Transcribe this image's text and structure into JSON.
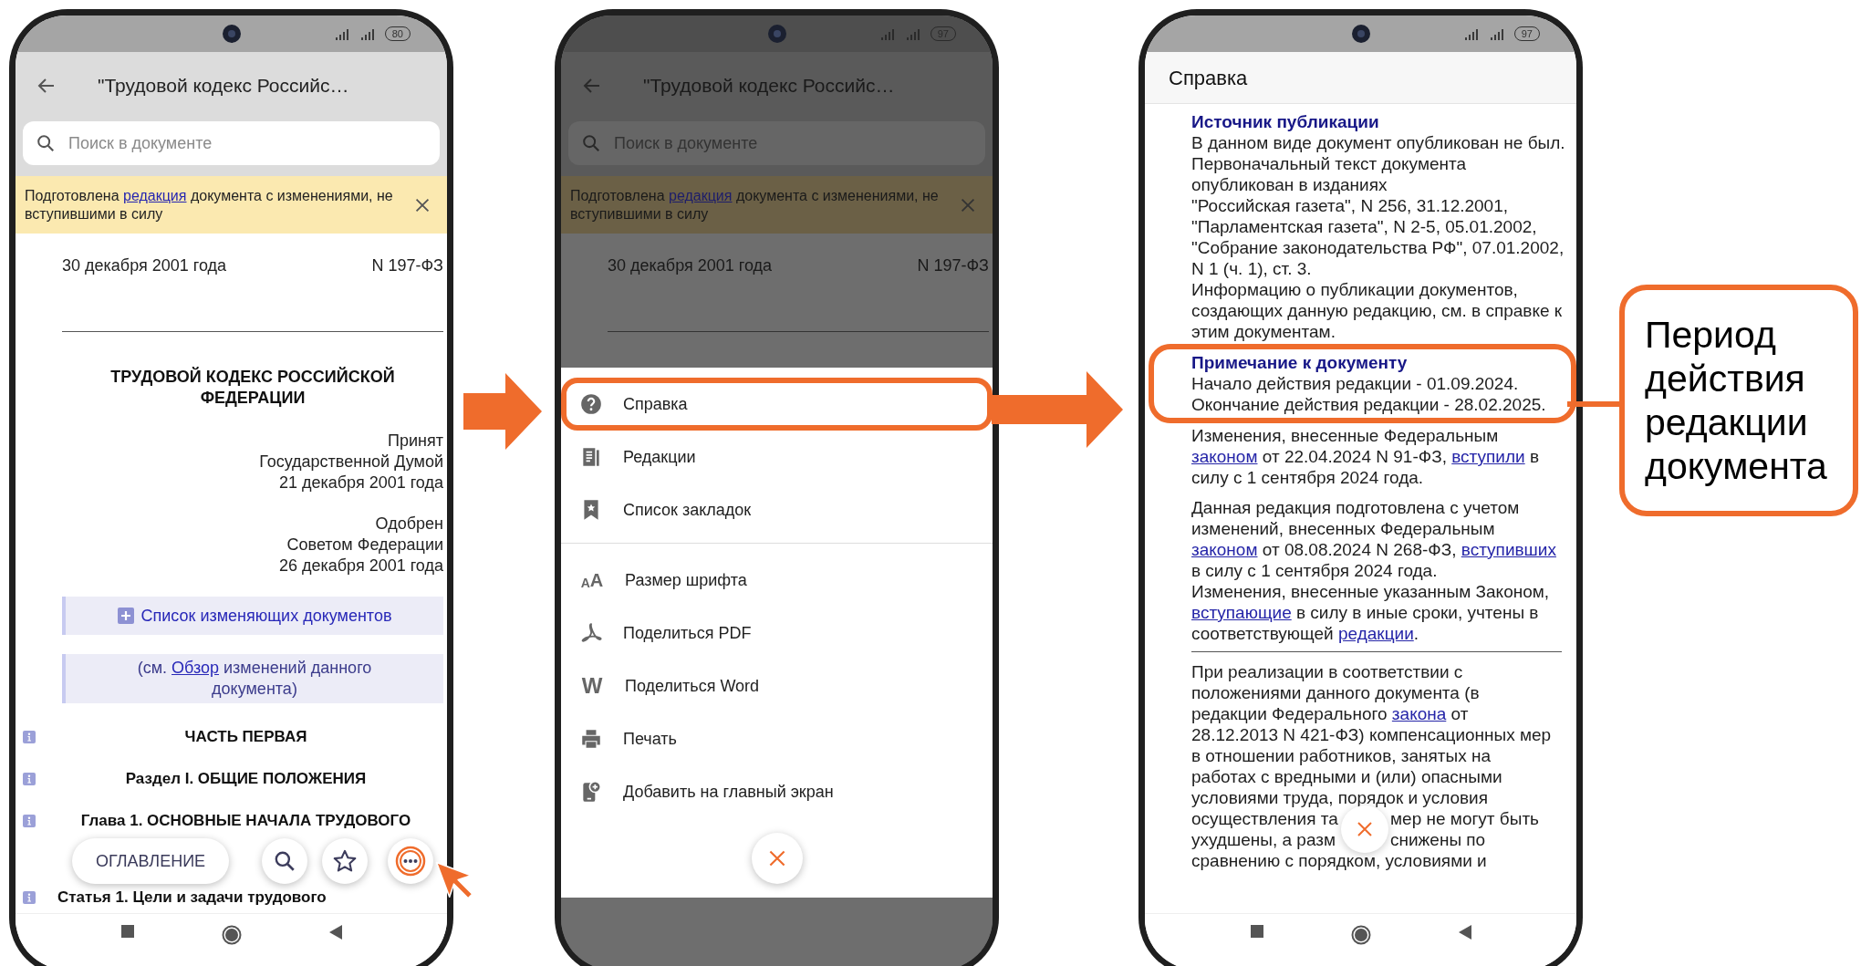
{
  "screen_1": {
    "battery": "80",
    "title": "\"Трудовой кодекс Российс…",
    "search_placeholder": "Поиск в документе",
    "banner": [
      "Подготовлена ",
      {
        "link": "редакция"
      },
      " документа с изменениями, не вступившими в силу"
    ],
    "doc_date": "30 декабря 2001 года",
    "doc_number": "N 197-ФЗ",
    "doc_title": "ТРУДОВОЙ КОДЕКС РОССИЙСКОЙ ФЕДЕРАЦИИ",
    "adoption": [
      "Принят",
      "Государственной Думой",
      "21 декабря 2001 года"
    ],
    "approval": [
      "Одобрен",
      "Советом Федерации",
      "26 декабря 2001 года"
    ],
    "changes_list": "Список изменяющих документов",
    "review_note": [
      "(см. ",
      {
        "link": "Обзор"
      },
      " изменений данного документа)"
    ],
    "headings": [
      "ЧАСТЬ ПЕРВАЯ",
      "Раздел I. ОБЩИЕ ПОЛОЖЕНИЯ",
      "Глава 1. ОСНОВНЫЕ НАЧАЛА ТРУДОВОГО"
    ],
    "contents_button": "ОГЛАВЛЕНИЕ",
    "more_highlighted": true,
    "article": "Статья 1. Цели и задачи трудового"
  },
  "screen_2": {
    "battery": "97",
    "title": "\"Трудовой кодекс Российс…",
    "search_placeholder": "Поиск в документе",
    "banner": [
      "Подготовлена ",
      {
        "link": "редакция"
      },
      " документа с изменениями, не вступившими в силу"
    ],
    "doc_date": "30 декабря 2001 года",
    "doc_number": "N 197-ФЗ",
    "menu_groups": [
      [
        {
          "kind": "help",
          "label": "Справка",
          "highlighted": true
        },
        {
          "kind": "editions",
          "label": "Редакции",
          "highlighted": false
        },
        {
          "kind": "bookmarks",
          "label": "Список закладок",
          "highlighted": false
        }
      ],
      [
        {
          "kind": "glyph",
          "glyph": "AA",
          "label": "Размер шрифта",
          "highlighted": false
        },
        {
          "kind": "pdf",
          "label": "Поделиться PDF",
          "highlighted": false
        },
        {
          "kind": "glyph",
          "glyph": "W",
          "label": "Поделиться Word",
          "highlighted": false
        },
        {
          "kind": "print",
          "label": "Печать",
          "highlighted": false
        },
        {
          "kind": "shortcut",
          "label": "Добавить на главный экран",
          "highlighted": false
        }
      ]
    ]
  },
  "screen_3": {
    "battery": "97",
    "header": "Справка",
    "blocks": [
      {
        "kind": "heading",
        "text": "Источник публикации"
      },
      {
        "kind": "text",
        "segments": [
          "В данном виде документ опубликован не был."
        ]
      },
      {
        "kind": "text",
        "segments": [
          "Первоначальный текст документа опубликован в изданиях"
        ]
      },
      {
        "kind": "text",
        "segments": [
          "\"Российская газета\", N 256, 31.12.2001,"
        ]
      },
      {
        "kind": "text",
        "segments": [
          "\"Парламентская газета\", N 2-5, 05.01.2002,"
        ]
      },
      {
        "kind": "text",
        "segments": [
          "\"Собрание законодательства РФ\", 07.01.2002, N 1 (ч. 1), ст. 3."
        ]
      },
      {
        "kind": "text",
        "segments": [
          "Информацию о публикации документов, создающих данную редакцию, см. в справке к этим документам."
        ]
      },
      {
        "kind": "note",
        "highlighted": true,
        "title": "Примечание к документу",
        "lines": [
          "Начало действия редакции - 01.09.2024.",
          "Окончание действия редакции - 28.02.2025."
        ]
      },
      {
        "kind": "text",
        "segments": [
          "Изменения, внесенные Федеральным ",
          {
            "link": "законом"
          },
          " от 22.04.2024 N 91-ФЗ, ",
          {
            "link": "вступили"
          },
          " в силу с 1 сентября 2024 года."
        ]
      },
      {
        "kind": "paragraph",
        "segments": [
          "Данная редакция подготовлена с учетом изменений, внесенных Федеральным ",
          {
            "link": "законом"
          },
          " от 08.08.2024 N 268-ФЗ, ",
          {
            "link": "вступивших"
          },
          " в силу с 1 сентября 2024 года."
        ]
      },
      {
        "kind": "text",
        "segments": [
          "Изменения, внесенные указанным Законом, ",
          {
            "link": "вступающие"
          },
          " в силу в иные сроки, учтены в соответствующей ",
          {
            "link": "редакции"
          },
          "."
        ]
      },
      {
        "kind": "rule"
      },
      {
        "kind": "lines",
        "lines": [
          [
            [
              "При реализации в соответствии с"
            ]
          ],
          [
            [
              "положениями данного документа (в"
            ]
          ],
          [
            [
              "редакции Федерального ",
              {
                "link": "закона"
              },
              " от"
            ]
          ],
          [
            [
              "28.12.2013 N 421-ФЗ) компенсационных мер"
            ]
          ],
          [
            [
              "в отношении работников, занятых на"
            ]
          ],
          [
            [
              "работах с вредными и (или) опасными"
            ]
          ],
          [
            [
              "условиями труда, порядок и условия"
            ]
          ],
          [
            [
              "осуществления та"
            ],
            [
              "мер не могут быть"
            ]
          ],
          [
            [
              "ухудшены, а разм"
            ],
            [
              "снижены по"
            ]
          ],
          [
            [
              "сравнению с порядком, условиями и"
            ]
          ]
        ]
      }
    ]
  },
  "callout": "Период действия редакции документа"
}
